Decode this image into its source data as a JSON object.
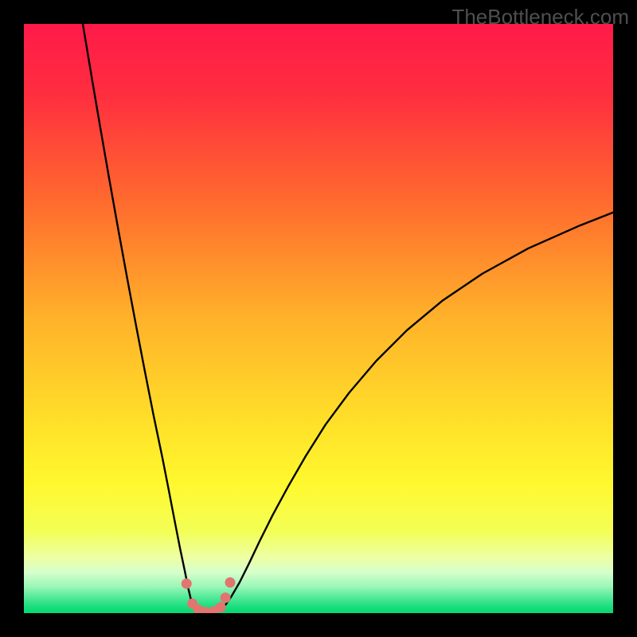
{
  "watermark": "TheBottleneck.com",
  "colors": {
    "black": "#000000",
    "curve": "#000000",
    "marker_fill": "#e2756f",
    "gradient_stops": [
      {
        "offset": 0.0,
        "color": "#ff1a49"
      },
      {
        "offset": 0.12,
        "color": "#ff2e3f"
      },
      {
        "offset": 0.3,
        "color": "#ff6a2e"
      },
      {
        "offset": 0.5,
        "color": "#ffb22a"
      },
      {
        "offset": 0.68,
        "color": "#ffe129"
      },
      {
        "offset": 0.78,
        "color": "#fff82e"
      },
      {
        "offset": 0.86,
        "color": "#f3ff55"
      },
      {
        "offset": 0.905,
        "color": "#edffa3"
      },
      {
        "offset": 0.93,
        "color": "#d7ffcc"
      },
      {
        "offset": 0.955,
        "color": "#9bf7b8"
      },
      {
        "offset": 0.975,
        "color": "#4ce895"
      },
      {
        "offset": 0.99,
        "color": "#17dd7e"
      },
      {
        "offset": 1.0,
        "color": "#05d96f"
      }
    ]
  },
  "chart_data": {
    "type": "line",
    "title": "",
    "xlabel": "",
    "ylabel": "",
    "xlim": [
      0,
      100
    ],
    "ylim": [
      0,
      100
    ],
    "series": [
      {
        "name": "left-branch",
        "x": [
          10.0,
          11.5,
          13.0,
          14.5,
          16.0,
          17.5,
          19.0,
          20.5,
          22.0,
          23.5,
          24.6,
          25.6,
          26.5,
          27.3,
          27.9,
          28.4,
          28.8
        ],
        "y": [
          100.0,
          91.0,
          82.2,
          73.6,
          65.2,
          57.0,
          49.0,
          41.2,
          33.6,
          26.4,
          20.8,
          15.6,
          11.0,
          7.2,
          4.2,
          2.1,
          0.9
        ]
      },
      {
        "name": "valley",
        "x": [
          28.8,
          29.4,
          30.2,
          31.0,
          32.0,
          33.0,
          34.0
        ],
        "y": [
          0.9,
          0.35,
          0.12,
          0.05,
          0.1,
          0.35,
          1.1
        ]
      },
      {
        "name": "right-branch",
        "x": [
          34.0,
          35.2,
          36.6,
          38.2,
          40.0,
          42.2,
          44.8,
          47.8,
          51.2,
          55.2,
          59.8,
          65.0,
          71.0,
          77.8,
          85.6,
          94.4,
          100.0
        ],
        "y": [
          1.1,
          2.8,
          5.2,
          8.4,
          12.2,
          16.6,
          21.4,
          26.6,
          32.0,
          37.4,
          42.8,
          48.0,
          53.0,
          57.6,
          61.9,
          65.8,
          68.0
        ]
      }
    ],
    "markers": {
      "name": "highlighted-points",
      "x": [
        27.6,
        28.6,
        29.6,
        30.8,
        32.2,
        33.4,
        34.2,
        35.0
      ],
      "y": [
        5.0,
        1.6,
        0.6,
        0.2,
        0.3,
        1.0,
        2.6,
        5.2
      ]
    }
  }
}
